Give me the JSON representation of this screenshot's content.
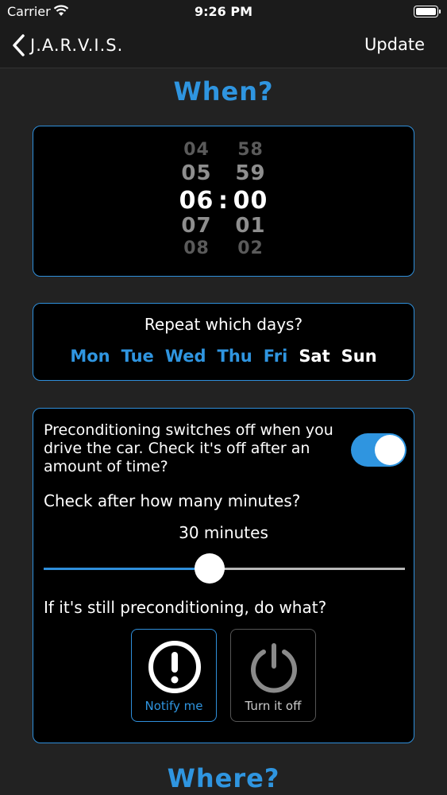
{
  "status_bar": {
    "carrier": "Carrier",
    "time": "9:26 PM"
  },
  "nav": {
    "back_label": "J.A.R.V.I.S.",
    "update_label": "Update"
  },
  "when_title": "When?",
  "time_picker": {
    "hours": [
      "04",
      "05",
      "06",
      "07",
      "08"
    ],
    "minutes": [
      "58",
      "59",
      "00",
      "01",
      "02"
    ],
    "separator": ":"
  },
  "repeat": {
    "label": "Repeat which days?",
    "days": [
      {
        "label": "Mon",
        "selected": true
      },
      {
        "label": "Tue",
        "selected": true
      },
      {
        "label": "Wed",
        "selected": true
      },
      {
        "label": "Thu",
        "selected": true
      },
      {
        "label": "Fri",
        "selected": true
      },
      {
        "label": "Sat",
        "selected": false
      },
      {
        "label": "Sun",
        "selected": false
      }
    ]
  },
  "precondition": {
    "description": "Preconditioning switches off when you drive the car. Check it's off after an amount of time?",
    "toggle_on": true,
    "check_label": "Check after how many minutes?",
    "minutes_label": "30 minutes",
    "slider_fraction": 0.46,
    "action_label": "If it's still preconditioning, do what?",
    "actions": [
      {
        "label": "Notify me",
        "icon": "exclamation-circle-icon",
        "selected": true
      },
      {
        "label": "Turn it off",
        "icon": "power-icon",
        "selected": false
      }
    ]
  },
  "where_title": "Where?",
  "colors": {
    "accent": "#2f95e0",
    "background": "#222222",
    "card": "#000000"
  }
}
